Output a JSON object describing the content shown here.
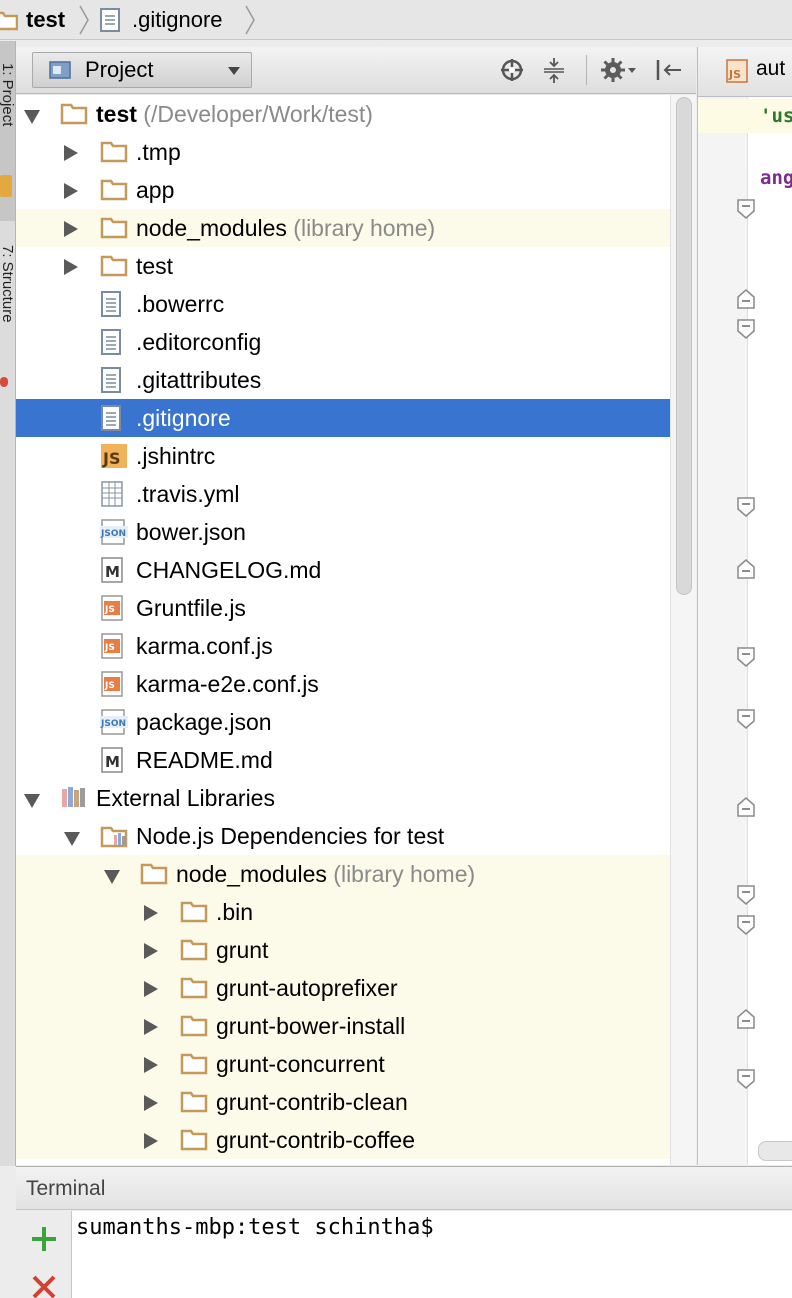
{
  "breadcrumb": {
    "project": "test",
    "file": ".gitignore"
  },
  "tool_strip": {
    "project_tab": "1: Project",
    "structure_tab": "7: Structure"
  },
  "project_panel": {
    "view_selector": "Project",
    "icons": [
      "locate-icon",
      "collapse-all-icon",
      "gear-icon",
      "hide-panel-icon"
    ]
  },
  "tree": {
    "root": {
      "name": "test",
      "path": "(/Developer/Work/test)"
    },
    "folders": [
      ".tmp",
      "app",
      "node_modules",
      "test"
    ],
    "node_modules_suffix": "(library home)",
    "files": [
      ".bowerrc",
      ".editorconfig",
      ".gitattributes",
      ".gitignore",
      ".jshintrc",
      ".travis.yml",
      "bower.json",
      "CHANGELOG.md",
      "Gruntfile.js",
      "karma.conf.js",
      "karma-e2e.conf.js",
      "package.json",
      "README.md"
    ],
    "external_libraries": "External Libraries",
    "node_deps": "Node.js Dependencies for test",
    "nm_lib": "node_modules",
    "nm_lib_suffix": "(library home)",
    "nm_children": [
      ".bin",
      "grunt",
      "grunt-autoprefixer",
      "grunt-bower-install",
      "grunt-concurrent",
      "grunt-contrib-clean",
      "grunt-contrib-coffee"
    ],
    "selected": ".gitignore"
  },
  "editor": {
    "tab_label": "aut",
    "line1": "'us",
    "line2": "ang"
  },
  "terminal": {
    "title": "Terminal",
    "prompt": "sumanths-mbp:test schintha$"
  },
  "colors": {
    "selection": "#3975d0",
    "folder": "#c49a5a",
    "highlight_row": "#fcfbe9"
  }
}
